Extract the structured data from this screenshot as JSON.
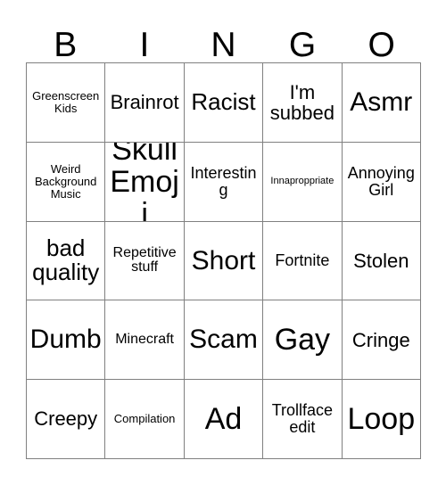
{
  "card": {
    "header_letters": [
      "B",
      "I",
      "N",
      "G",
      "O"
    ],
    "columns": 5,
    "rows": 5,
    "border_color": "#808080",
    "background_color": "#ffffff",
    "text_color": "#000000",
    "cells": [
      {
        "text": "Greenscreen Kids",
        "size": "fs-xxs"
      },
      {
        "text": "Brainrot",
        "size": "fs-md"
      },
      {
        "text": "Racist",
        "size": "fs-lg"
      },
      {
        "text": "I'm subbed",
        "size": "fs-md"
      },
      {
        "text": "Asmr",
        "size": "fs-xl"
      },
      {
        "text": "Weird Background Music",
        "size": "fs-xxs"
      },
      {
        "text": "Skull Emoji",
        "size": "fs-xxl"
      },
      {
        "text": "Interesting",
        "size": "fs-sm"
      },
      {
        "text": "Innaproppriate",
        "size": "fs-tiny"
      },
      {
        "text": "Annoying Girl",
        "size": "fs-sm"
      },
      {
        "text": "bad quality",
        "size": "fs-lg"
      },
      {
        "text": "Repetitive stuff",
        "size": "fs-xs"
      },
      {
        "text": "Short",
        "size": "fs-xl"
      },
      {
        "text": "Fortnite",
        "size": "fs-sm"
      },
      {
        "text": "Stolen",
        "size": "fs-md"
      },
      {
        "text": "Dumb",
        "size": "fs-xl"
      },
      {
        "text": "Minecraft",
        "size": "fs-xs"
      },
      {
        "text": "Scam",
        "size": "fs-xl"
      },
      {
        "text": "Gay",
        "size": "fs-xxl"
      },
      {
        "text": "Cringe",
        "size": "fs-md"
      },
      {
        "text": "Creepy",
        "size": "fs-md"
      },
      {
        "text": "Compilation",
        "size": "fs-xxs"
      },
      {
        "text": "Ad",
        "size": "fs-xxl"
      },
      {
        "text": "Trollface edit",
        "size": "fs-sm"
      },
      {
        "text": "Loop",
        "size": "fs-xxl"
      }
    ]
  }
}
